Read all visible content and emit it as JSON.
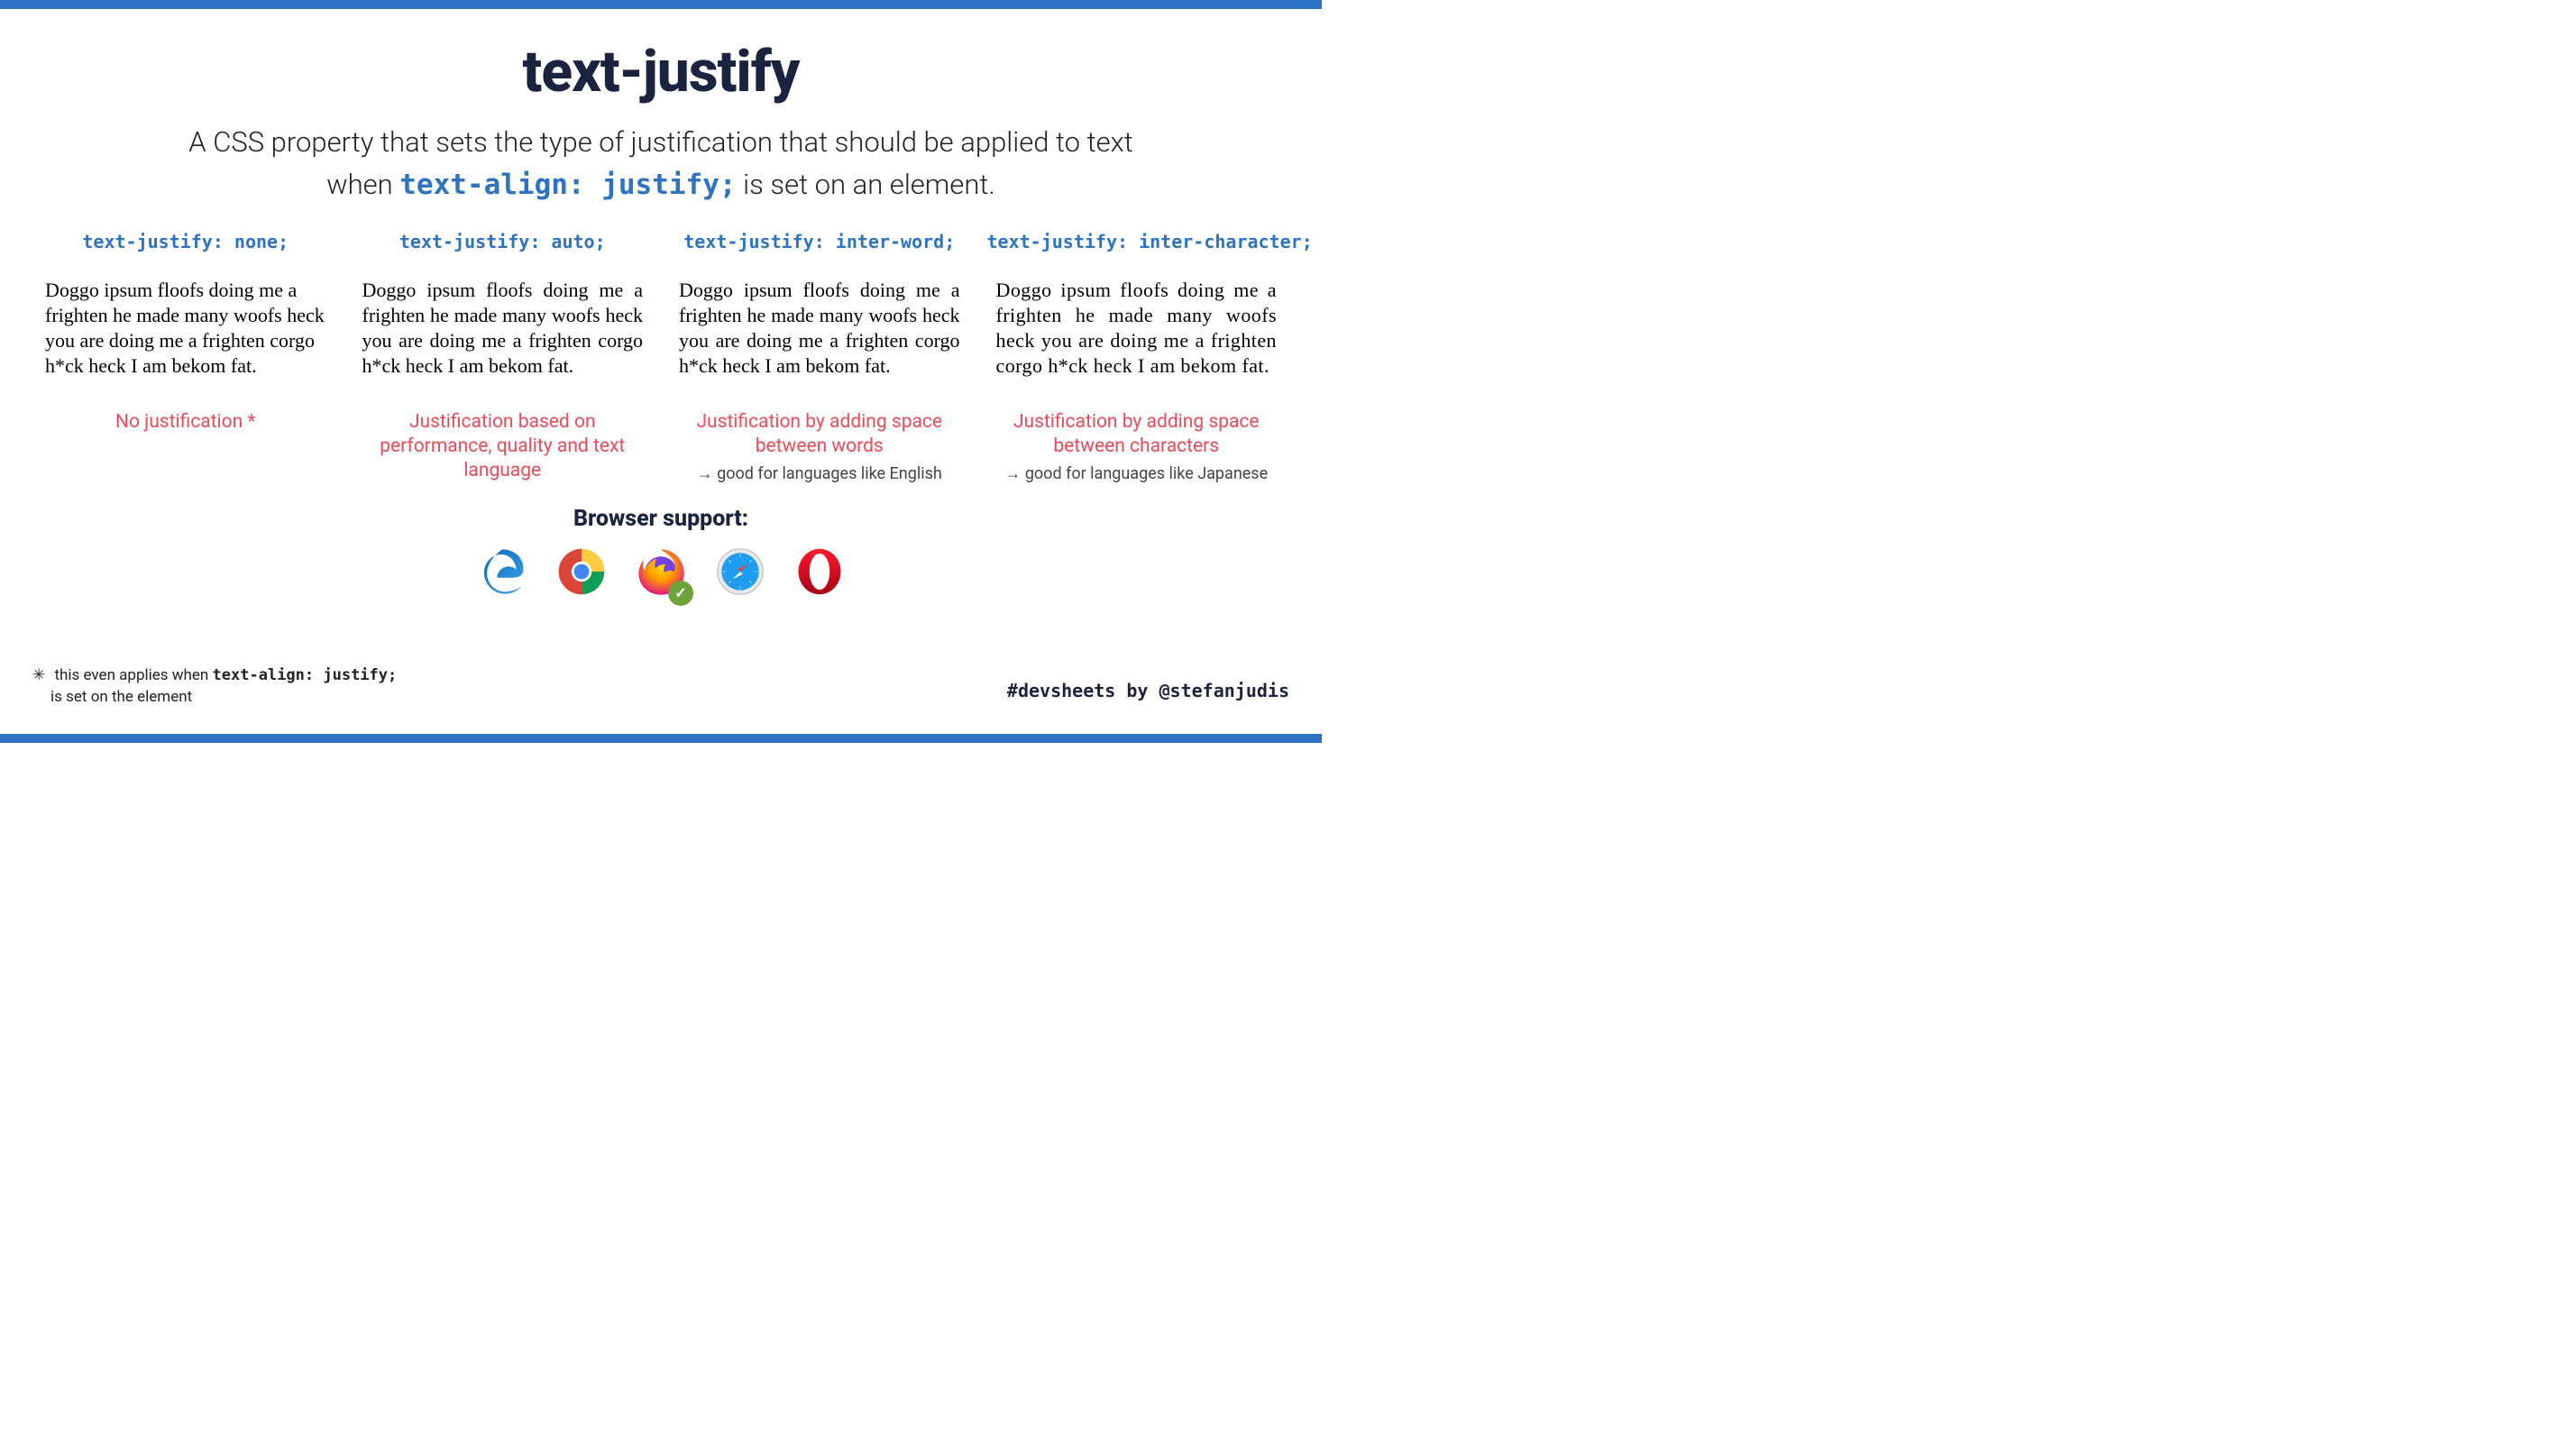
{
  "title": "text-justify",
  "subtitle": {
    "part1": "A CSS property that sets the type of justification that should be applied to text",
    "part2_before": "when ",
    "code": "text-align: justify;",
    "part2_after": " is set on an element."
  },
  "sample_text": "Doggo ipsum floofs doing me a frighten he made many woofs heck you are doing me a frighten corgo h*ck heck I am bekom fat.",
  "columns": [
    {
      "header": "text-justify: none;",
      "caption": "No justification *",
      "note": ""
    },
    {
      "header": "text-justify: auto;",
      "caption": "Justification based on performance, quality and text language",
      "note": ""
    },
    {
      "header": "text-justify: inter-word;",
      "caption": "Justification by adding space between words",
      "note": "good for languages like English"
    },
    {
      "header": "text-justify: inter-character;",
      "caption": "Justification by adding space between characters",
      "note": "good for languages like Japanese"
    }
  ],
  "browser_support_label": "Browser support:",
  "browsers": {
    "edge": "Edge",
    "chrome": "Chrome",
    "firefox": "Firefox",
    "safari": "Safari",
    "opera": "Opera"
  },
  "footnote": {
    "star": "✳",
    "text_before": "this even applies when ",
    "code": "text-align: justify;",
    "text_after": "is set on the element"
  },
  "credit": "#devsheets by @stefanjudis"
}
